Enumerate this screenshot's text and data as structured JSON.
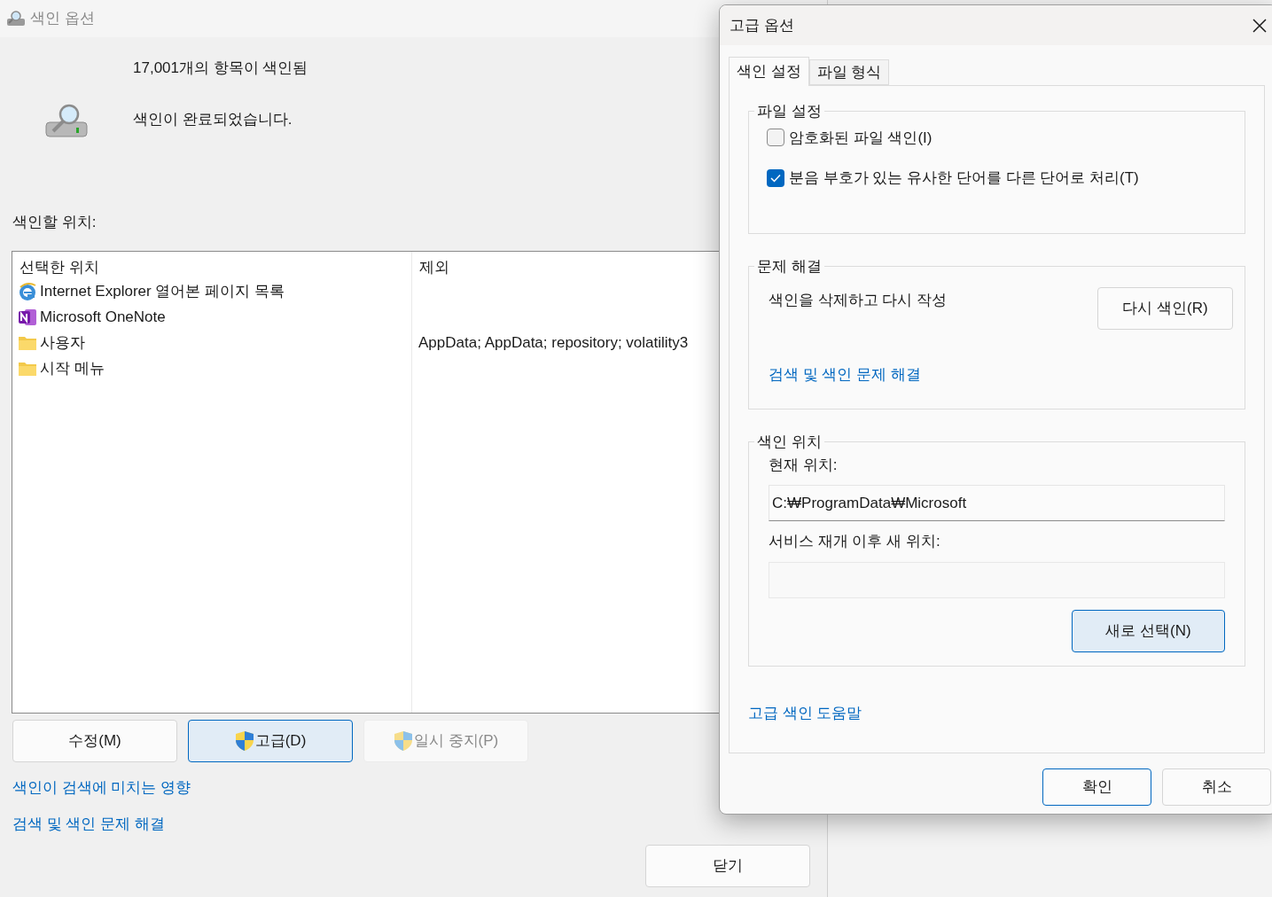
{
  "main_window": {
    "title": "색인 옵션",
    "status_count": "17,001개의 항목이 색인됨",
    "status_message": "색인이 완료되었습니다.",
    "locations_label": "색인할 위치:",
    "table": {
      "columns": [
        "선택한 위치",
        "제외"
      ],
      "rows": [
        {
          "kind": "browser",
          "location": "Internet Explorer 열어본 페이지 목록"
        },
        {
          "kind": "notes",
          "location": "Microsoft OneNote"
        },
        {
          "kind": "folder",
          "location": "사용자",
          "exclude": "AppData; AppData; repository; volatility3"
        },
        {
          "kind": "folder",
          "location": "시작 메뉴"
        }
      ]
    },
    "buttons": [
      {
        "label": "수정(M)",
        "shield": false,
        "focused": false,
        "disabled": false
      },
      {
        "label": "고급(D)",
        "shield": true,
        "focused": true,
        "disabled": false
      },
      {
        "label": "일시 중지(P)",
        "shield": true,
        "focused": false,
        "disabled": true
      }
    ],
    "links": [
      "색인이 검색에 미치는 영향",
      "검색 및 색인 문제 해결"
    ],
    "close_button": "닫기"
  },
  "dialog": {
    "title": "고급 옵션",
    "tabs": [
      {
        "label": "색인 설정",
        "selected": true
      },
      {
        "label": "파일 형식",
        "selected": false
      }
    ],
    "file_settings": {
      "title": "파일 설정",
      "checkboxes": [
        {
          "label": "암호화된 파일 색인(I)",
          "checked": false
        },
        {
          "label": "분음 부호가 있는 유사한 단어를 다른 단어로 처리(T)",
          "checked": true
        }
      ]
    },
    "troubleshooting": {
      "title": "문제 해결",
      "description": "색인을 삭제하고 다시 작성",
      "button": "다시 색인(R)",
      "link": "검색 및 색인 문제 해결"
    },
    "index_location": {
      "title": "색인 위치",
      "current_label": "현재 위치:",
      "current_value": "C:₩ProgramData₩Microsoft",
      "new_label": "서비스 재개 이후 새 위치:",
      "button": "새로 선택(N)"
    },
    "help_link": "고급 색인 도움말",
    "buttons": [
      {
        "label": "확인",
        "focused": true
      },
      {
        "label": "취소",
        "focused": false
      }
    ]
  }
}
